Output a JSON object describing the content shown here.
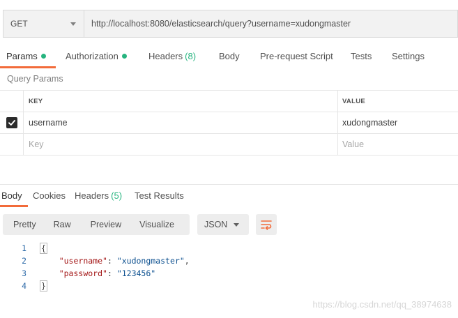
{
  "request": {
    "method": "GET",
    "url": "http://localhost:8080/elasticsearch/query?username=xudongmaster"
  },
  "request_tabs": [
    {
      "label": "Params",
      "dot": true
    },
    {
      "label": "Authorization",
      "dot": true
    },
    {
      "label": "Headers",
      "count": "(8)"
    },
    {
      "label": "Body"
    },
    {
      "label": "Pre-request Script"
    },
    {
      "label": "Tests"
    },
    {
      "label": "Settings"
    }
  ],
  "query_params": {
    "title": "Query Params",
    "columns": {
      "key": "KEY",
      "value": "VALUE"
    },
    "rows": [
      {
        "checked": true,
        "key": "username",
        "value": "xudongmaster"
      }
    ],
    "placeholder": {
      "key": "Key",
      "value": "Value"
    }
  },
  "response_tabs": [
    {
      "label": "Body"
    },
    {
      "label": "Cookies"
    },
    {
      "label": "Headers",
      "count": "(5)"
    },
    {
      "label": "Test Results"
    }
  ],
  "view_modes": [
    "Pretty",
    "Raw",
    "Preview",
    "Visualize"
  ],
  "format": "JSON",
  "body_lines": [
    {
      "num": "1",
      "text": "{"
    },
    {
      "num": "2",
      "key": "\"username\"",
      "value": "\"xudongmaster\"",
      "trail": ","
    },
    {
      "num": "3",
      "key": "\"password\"",
      "value": "\"123456\"",
      "trail": ""
    },
    {
      "num": "4",
      "text": "}"
    }
  ],
  "watermark": "https://blog.csdn.net/qq_38974638",
  "colors": {
    "accent": "#f26b3a",
    "indicator": "#26b47f"
  }
}
